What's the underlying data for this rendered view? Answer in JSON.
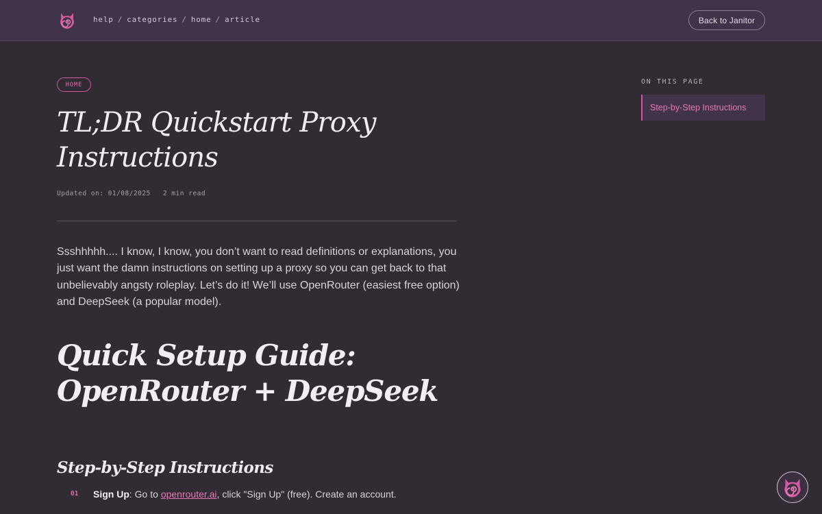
{
  "header": {
    "breadcrumbs": [
      "help",
      "categories",
      "home",
      "article"
    ],
    "back_button": "Back to Janitor",
    "logo_icon": "spiral-cat-logo-icon"
  },
  "article": {
    "tag": "HOME",
    "title": "TL;DR Quickstart Proxy Instructions",
    "updated": "Updated on: 01/08/2025",
    "read_time": "2 min read",
    "intro": "Ssshhhhh.... I know, I know, you don’t want to read definitions or explanations, you just want the damn instructions on setting up a proxy so you can get back to that unbelievably angsty roleplay. Let’s do it! We’ll use OpenRouter (easiest free option) and DeepSeek (a popular model).",
    "section_heading": "Quick Setup Guide: OpenRouter + DeepSeek",
    "subsection_heading": "Step-by-Step Instructions",
    "steps": [
      {
        "num": "01",
        "label": "Sign Up",
        "text_before": ": Go to ",
        "link": "openrouter.ai",
        "text_after": ", click \"Sign Up\" (free). Create an account."
      }
    ]
  },
  "toc": {
    "heading": "ON THIS PAGE",
    "items": [
      "Step-by-Step Instructions"
    ]
  },
  "colors": {
    "accent": "#d35aa0",
    "background": "#312b34",
    "header_bg": "#41334a"
  },
  "floating_button_icon": "spiral-cat-avatar-icon"
}
